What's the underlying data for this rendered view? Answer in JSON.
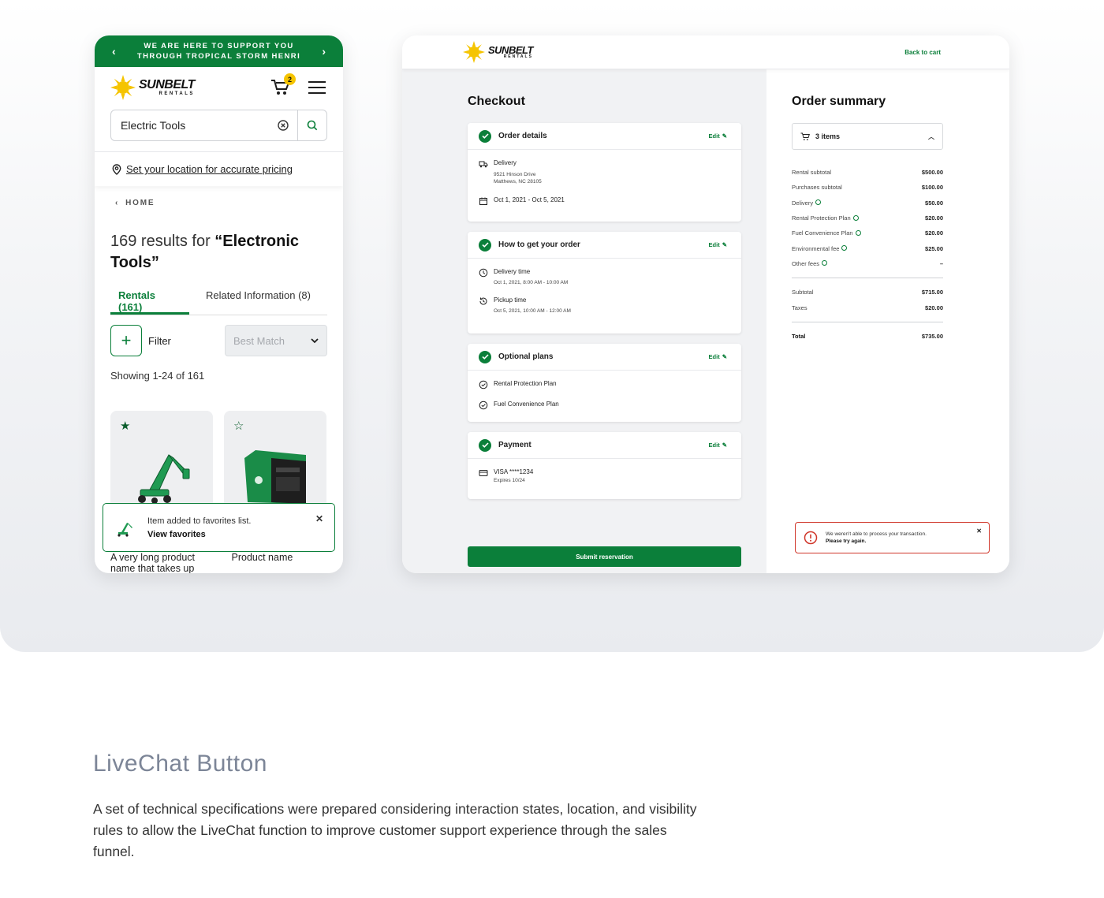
{
  "mobile": {
    "banner": {
      "line1": "WE ARE HERE TO SUPPORT YOU",
      "line2": "THROUGH TROPICAL STORM HENRI"
    },
    "logo": {
      "name": "SUNBELT",
      "sub": "RENTALS"
    },
    "cart_count": "2",
    "search": {
      "value": "Electric Tools"
    },
    "location_text": "Set your location for accurate pricing",
    "breadcrumb": "HOME",
    "results": {
      "prefix": "169 results for ",
      "query": "“Electronic Tools”"
    },
    "tabs": [
      {
        "label": "Rentals (161)"
      },
      {
        "label": "Related Information (8)"
      }
    ],
    "filter_label": "Filter",
    "sort_value": "Best Match",
    "showing": "Showing 1-24 of 161",
    "products": [
      {
        "name": "A very long product name that takes up"
      },
      {
        "name": "Product name"
      }
    ],
    "toast": {
      "message": "Item added to favorites list.",
      "link": "View favorites"
    },
    "colors": {
      "brand": "#0b7f3a",
      "badge": "#f5c400"
    }
  },
  "desktop": {
    "logo": {
      "name": "SUNBELT",
      "sub": "RENTALS"
    },
    "back_link": "Back to cart",
    "checkout_title": "Checkout",
    "edit_label": "Edit",
    "sections": {
      "order_details": {
        "title": "Order details",
        "delivery_label": "Delivery",
        "address1": "9521 Hinson Drive",
        "address2": "Matthews, NC 28105",
        "dates": "Oct 1, 2021 - Oct 5, 2021"
      },
      "how": {
        "title": "How to get your order",
        "delivery_time_label": "Delivery time",
        "delivery_time": "Oct 1, 2021, 8:00 AM - 10:00 AM",
        "pickup_time_label": "Pickup time",
        "pickup_time": "Oct 5, 2021, 10:00 AM - 12:00 AM"
      },
      "plans": {
        "title": "Optional plans",
        "items": [
          "Rental Protection Plan",
          "Fuel Convenience Plan"
        ]
      },
      "payment": {
        "title": "Payment",
        "card": "VISA ****1234",
        "expires": "Expires 10/24"
      }
    },
    "submit_label": "Submit reservation",
    "summary": {
      "title": "Order summary",
      "items_label": "3 items",
      "lines": [
        {
          "label": "Rental subtotal",
          "amount": "$500.00"
        },
        {
          "label": "Purchases subtotal",
          "amount": "$100.00"
        },
        {
          "label": "Delivery",
          "amount": "$50.00"
        },
        {
          "label": "Rental Protection Plan",
          "amount": "$20.00"
        },
        {
          "label": "Fuel Convenience Plan",
          "amount": "$20.00"
        },
        {
          "label": "Environmental fee",
          "amount": "$25.00"
        },
        {
          "label": "Other fees",
          "amount": "–"
        }
      ],
      "subtotal": {
        "label": "Subtotal",
        "amount": "$715.00"
      },
      "taxes": {
        "label": "Taxes",
        "amount": "$20.00"
      },
      "total": {
        "label": "Total",
        "amount": "$735.00"
      }
    },
    "error": {
      "message": "We weren't able to process your transaction.",
      "retry": "Please try again."
    },
    "colors": {
      "error": "#d0362a"
    }
  },
  "section": {
    "heading": "LiveChat Button",
    "description": "A set of technical specifications were prepared considering interaction states, location, and visibility rules to allow the LiveChat function to improve customer support experience through the sales funnel."
  }
}
